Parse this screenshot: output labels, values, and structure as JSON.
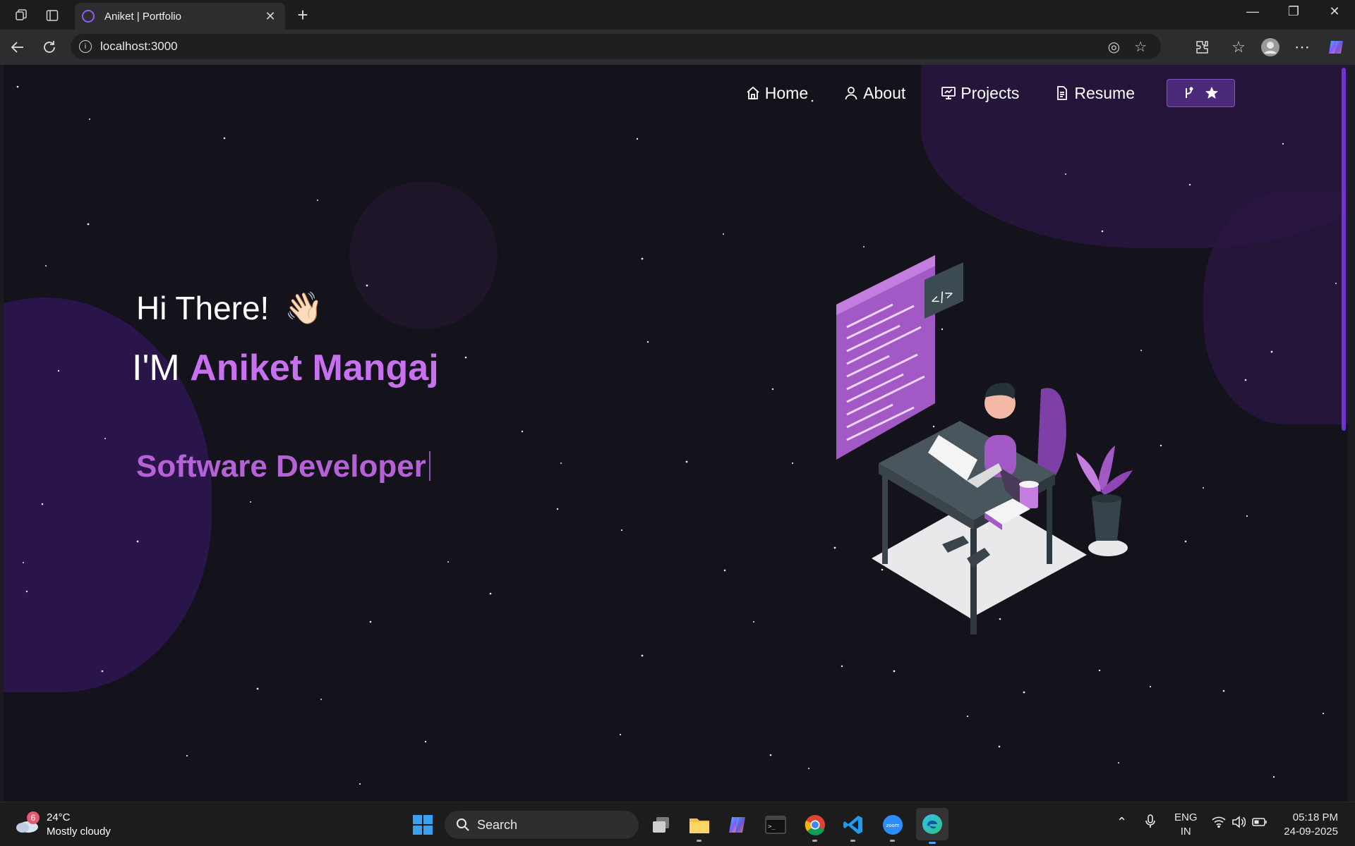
{
  "browser": {
    "tab_title": "Aniket | Portfolio",
    "tab_close": "✕",
    "new_tab": "+",
    "url": "localhost:3000",
    "window_controls": {
      "minimize": "—",
      "maximize": "❐",
      "close": "✕"
    }
  },
  "navbar": {
    "items": [
      {
        "label": "Home",
        "icon": "home-icon"
      },
      {
        "label": "About",
        "icon": "user-icon"
      },
      {
        "label": "Projects",
        "icon": "projects-icon"
      },
      {
        "label": "Resume",
        "icon": "document-icon"
      }
    ],
    "github_button": {
      "icons": [
        "fork-icon",
        "star-icon"
      ]
    }
  },
  "hero": {
    "greeting": "Hi There!",
    "wave_emoji": "👋🏻",
    "intro_prefix": "I'M",
    "name": "Aniket Mangaj",
    "typewriter_text": "Software Developer"
  },
  "taskbar": {
    "weather": {
      "badge": "6",
      "temperature": "24°C",
      "condition": "Mostly cloudy"
    },
    "search_placeholder": "Search",
    "language": {
      "line1": "ENG",
      "line2": "IN"
    },
    "clock": {
      "time": "05:18 PM",
      "date": "24-09-2025"
    }
  },
  "colors": {
    "accent": "#c770f0",
    "role_text": "#b562d6",
    "background": "#14121a",
    "button": "#4b2a7a"
  }
}
